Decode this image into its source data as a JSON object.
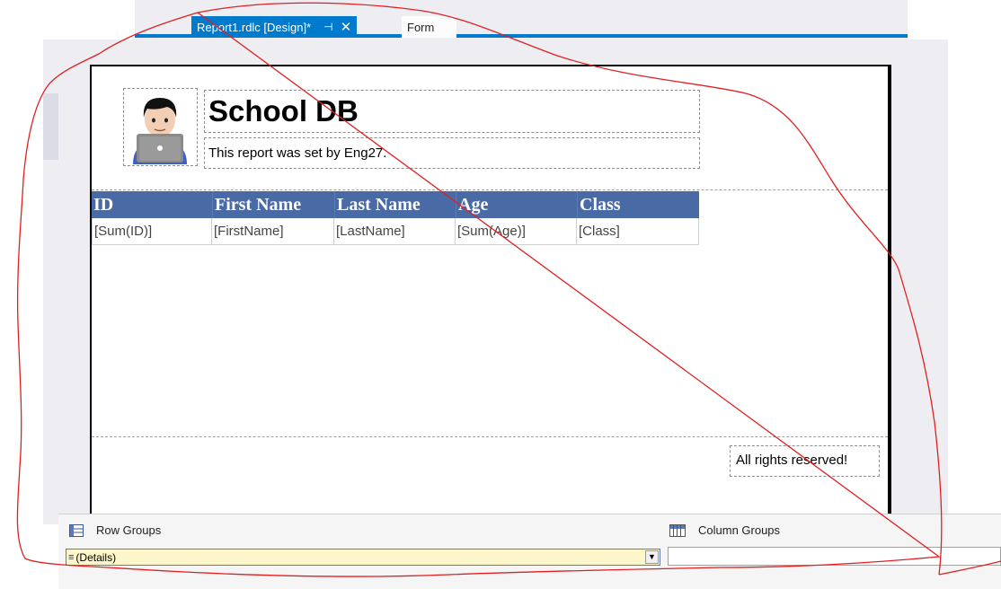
{
  "tabs": {
    "active": {
      "label": "Report1.rdlc [Design]*",
      "pin": "⊣",
      "close": "✕"
    },
    "next": {
      "label": "Form"
    }
  },
  "report": {
    "title": "School DB",
    "subtitle": "This report was set by Eng27.",
    "footer": "All rights reserved!",
    "table": {
      "headers": [
        "ID",
        "First Name",
        "Last Name",
        "Age",
        "Class"
      ],
      "row": [
        "[Sum(ID)]",
        "[FirstName]",
        "[LastName]",
        "[Sum(Age)]",
        "[Class]"
      ],
      "header_color": "#4a6aa5"
    }
  },
  "grouping": {
    "row_groups_label": "Row Groups",
    "column_groups_label": "Column Groups",
    "row_group_value": "(Details)"
  },
  "colors": {
    "accent": "#007acc",
    "annotation_stroke": "#e02020",
    "selection_fill": "#fef6cb"
  }
}
